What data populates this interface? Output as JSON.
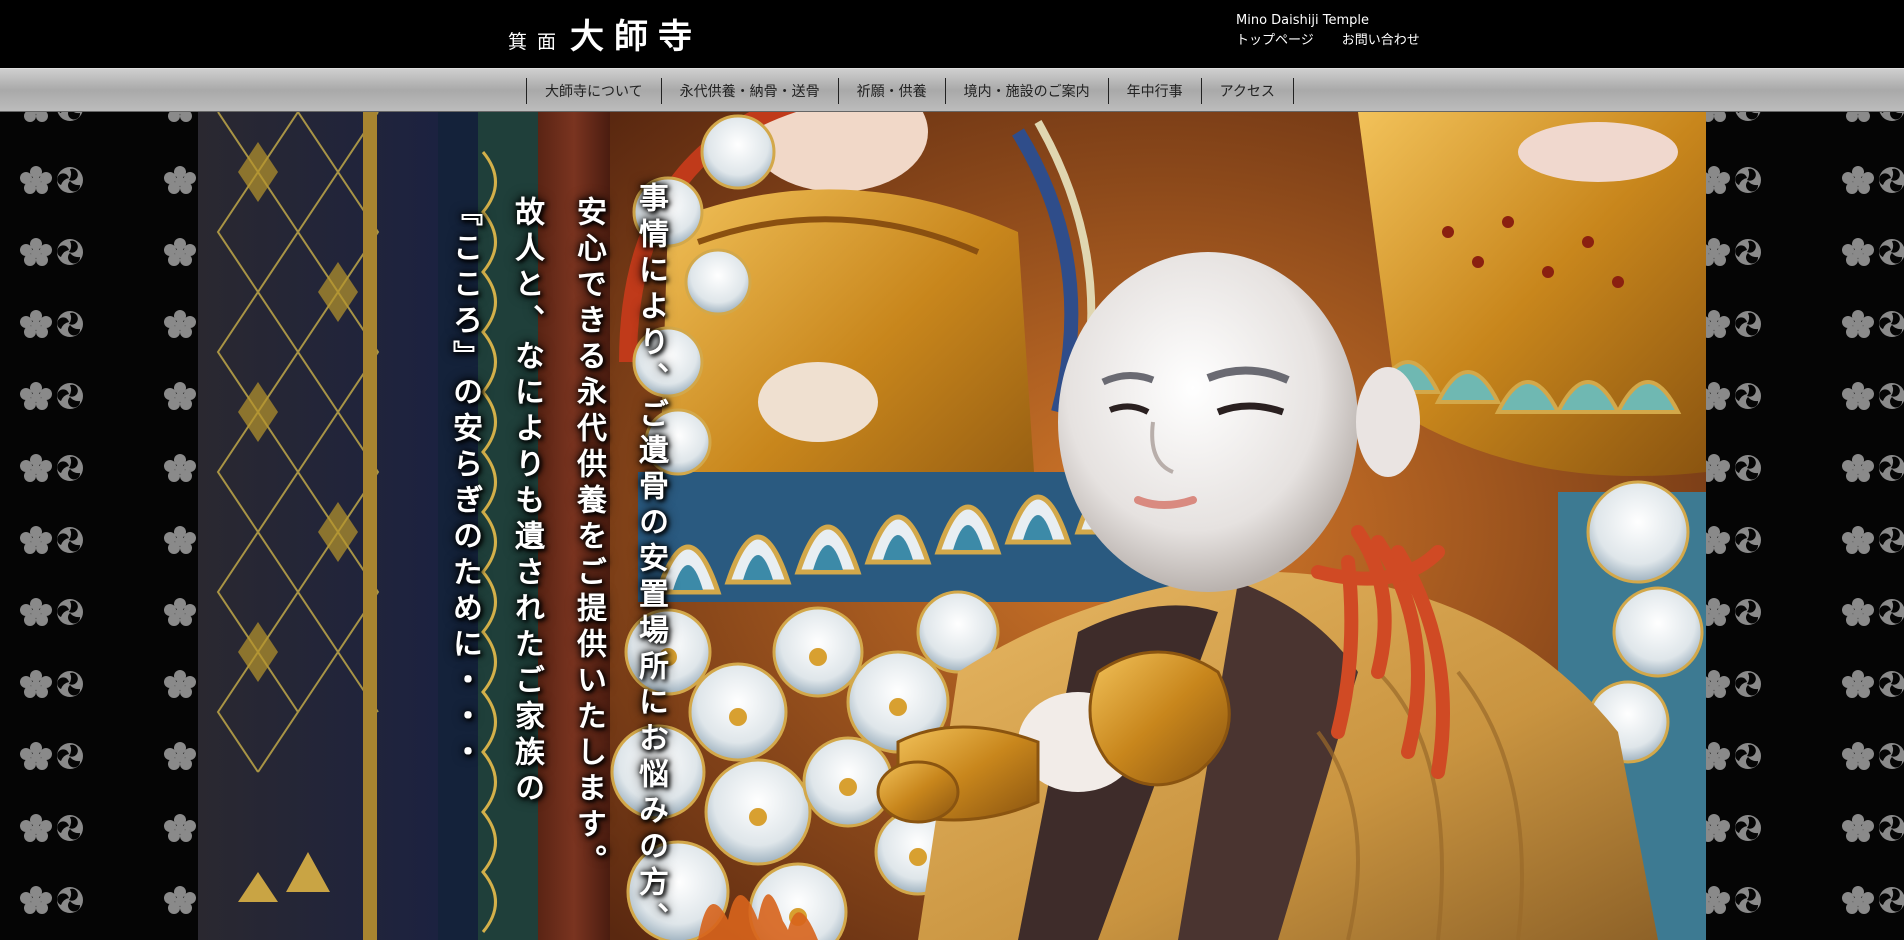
{
  "site": {
    "logo_small": "箕面",
    "logo_big": "大師寺",
    "english_name": "Mino Daishiji Temple"
  },
  "header_links": {
    "top_page": "トップページ",
    "contact": "お問い合わせ"
  },
  "nav": {
    "items": [
      "大師寺について",
      "永代供養・納骨・送骨",
      "祈願・供養",
      "境内・施設のご案内",
      "年中行事",
      "アクセス"
    ]
  },
  "hero": {
    "lines": [
      "事情により、ご遺骨の安置場所にお悩みの方、",
      "安心できる永代供養をご提供いたします。",
      "故人と、なによりも遺されたご家族の",
      "『こころ』の安らぎのために・・・"
    ]
  },
  "colors": {
    "header_bg": "#000000",
    "nav_bg": "#b5b5b5",
    "text_light": "#ffffff",
    "pattern": "#8a8a8a"
  },
  "icons": {
    "side_pattern": [
      "paulownia-crest-icon",
      "tomoe-crest-icon"
    ]
  }
}
